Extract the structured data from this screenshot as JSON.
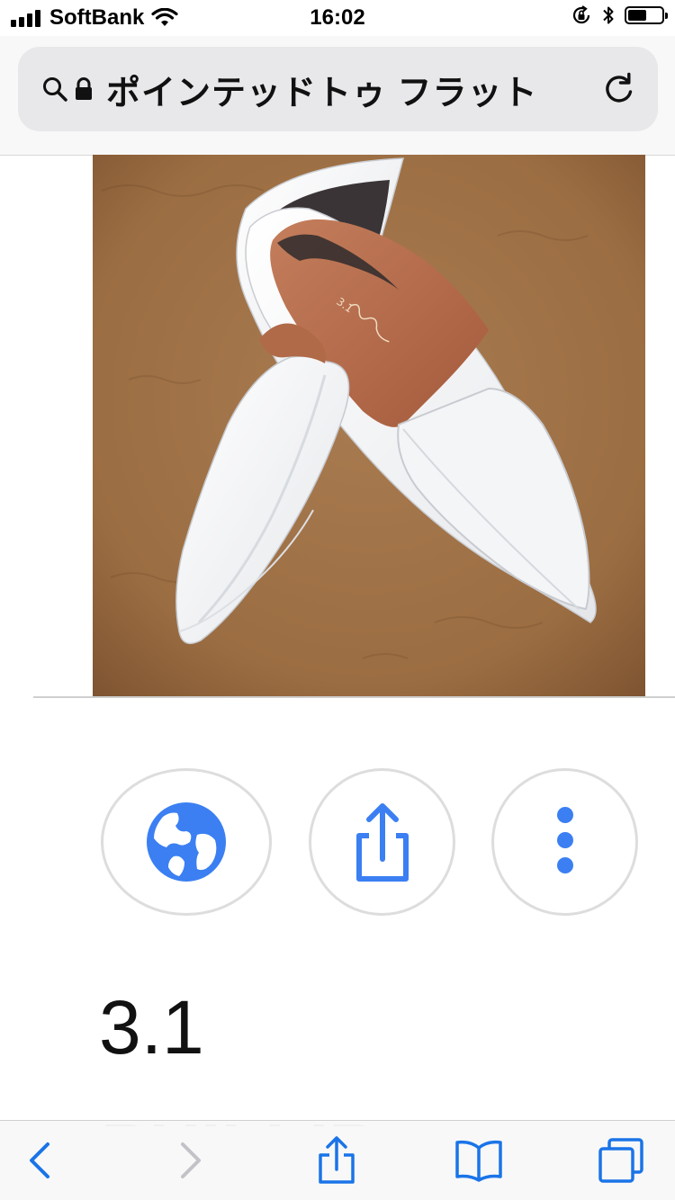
{
  "status_bar": {
    "carrier": "SoftBank",
    "time": "16:02",
    "signal_bars": 4,
    "battery_level": 0.55
  },
  "address_bar": {
    "title": "ポインテッドトゥ フラット",
    "icons": [
      "search-icon",
      "lock-icon",
      "reload-icon"
    ]
  },
  "result": {
    "title": "3.1",
    "subtitle": "PHILLIP"
  },
  "actions": {
    "icons": [
      "globe-icon",
      "share-icon",
      "more-vertical-icon"
    ]
  },
  "toolbar": {
    "icons": [
      "back-icon",
      "forward-icon",
      "share-icon",
      "bookmarks-icon",
      "tabs-icon"
    ]
  },
  "colors": {
    "accent": "#3b7ff2",
    "toolbar_blue": "#1a74e8",
    "disabled": "#c2c2c8"
  }
}
